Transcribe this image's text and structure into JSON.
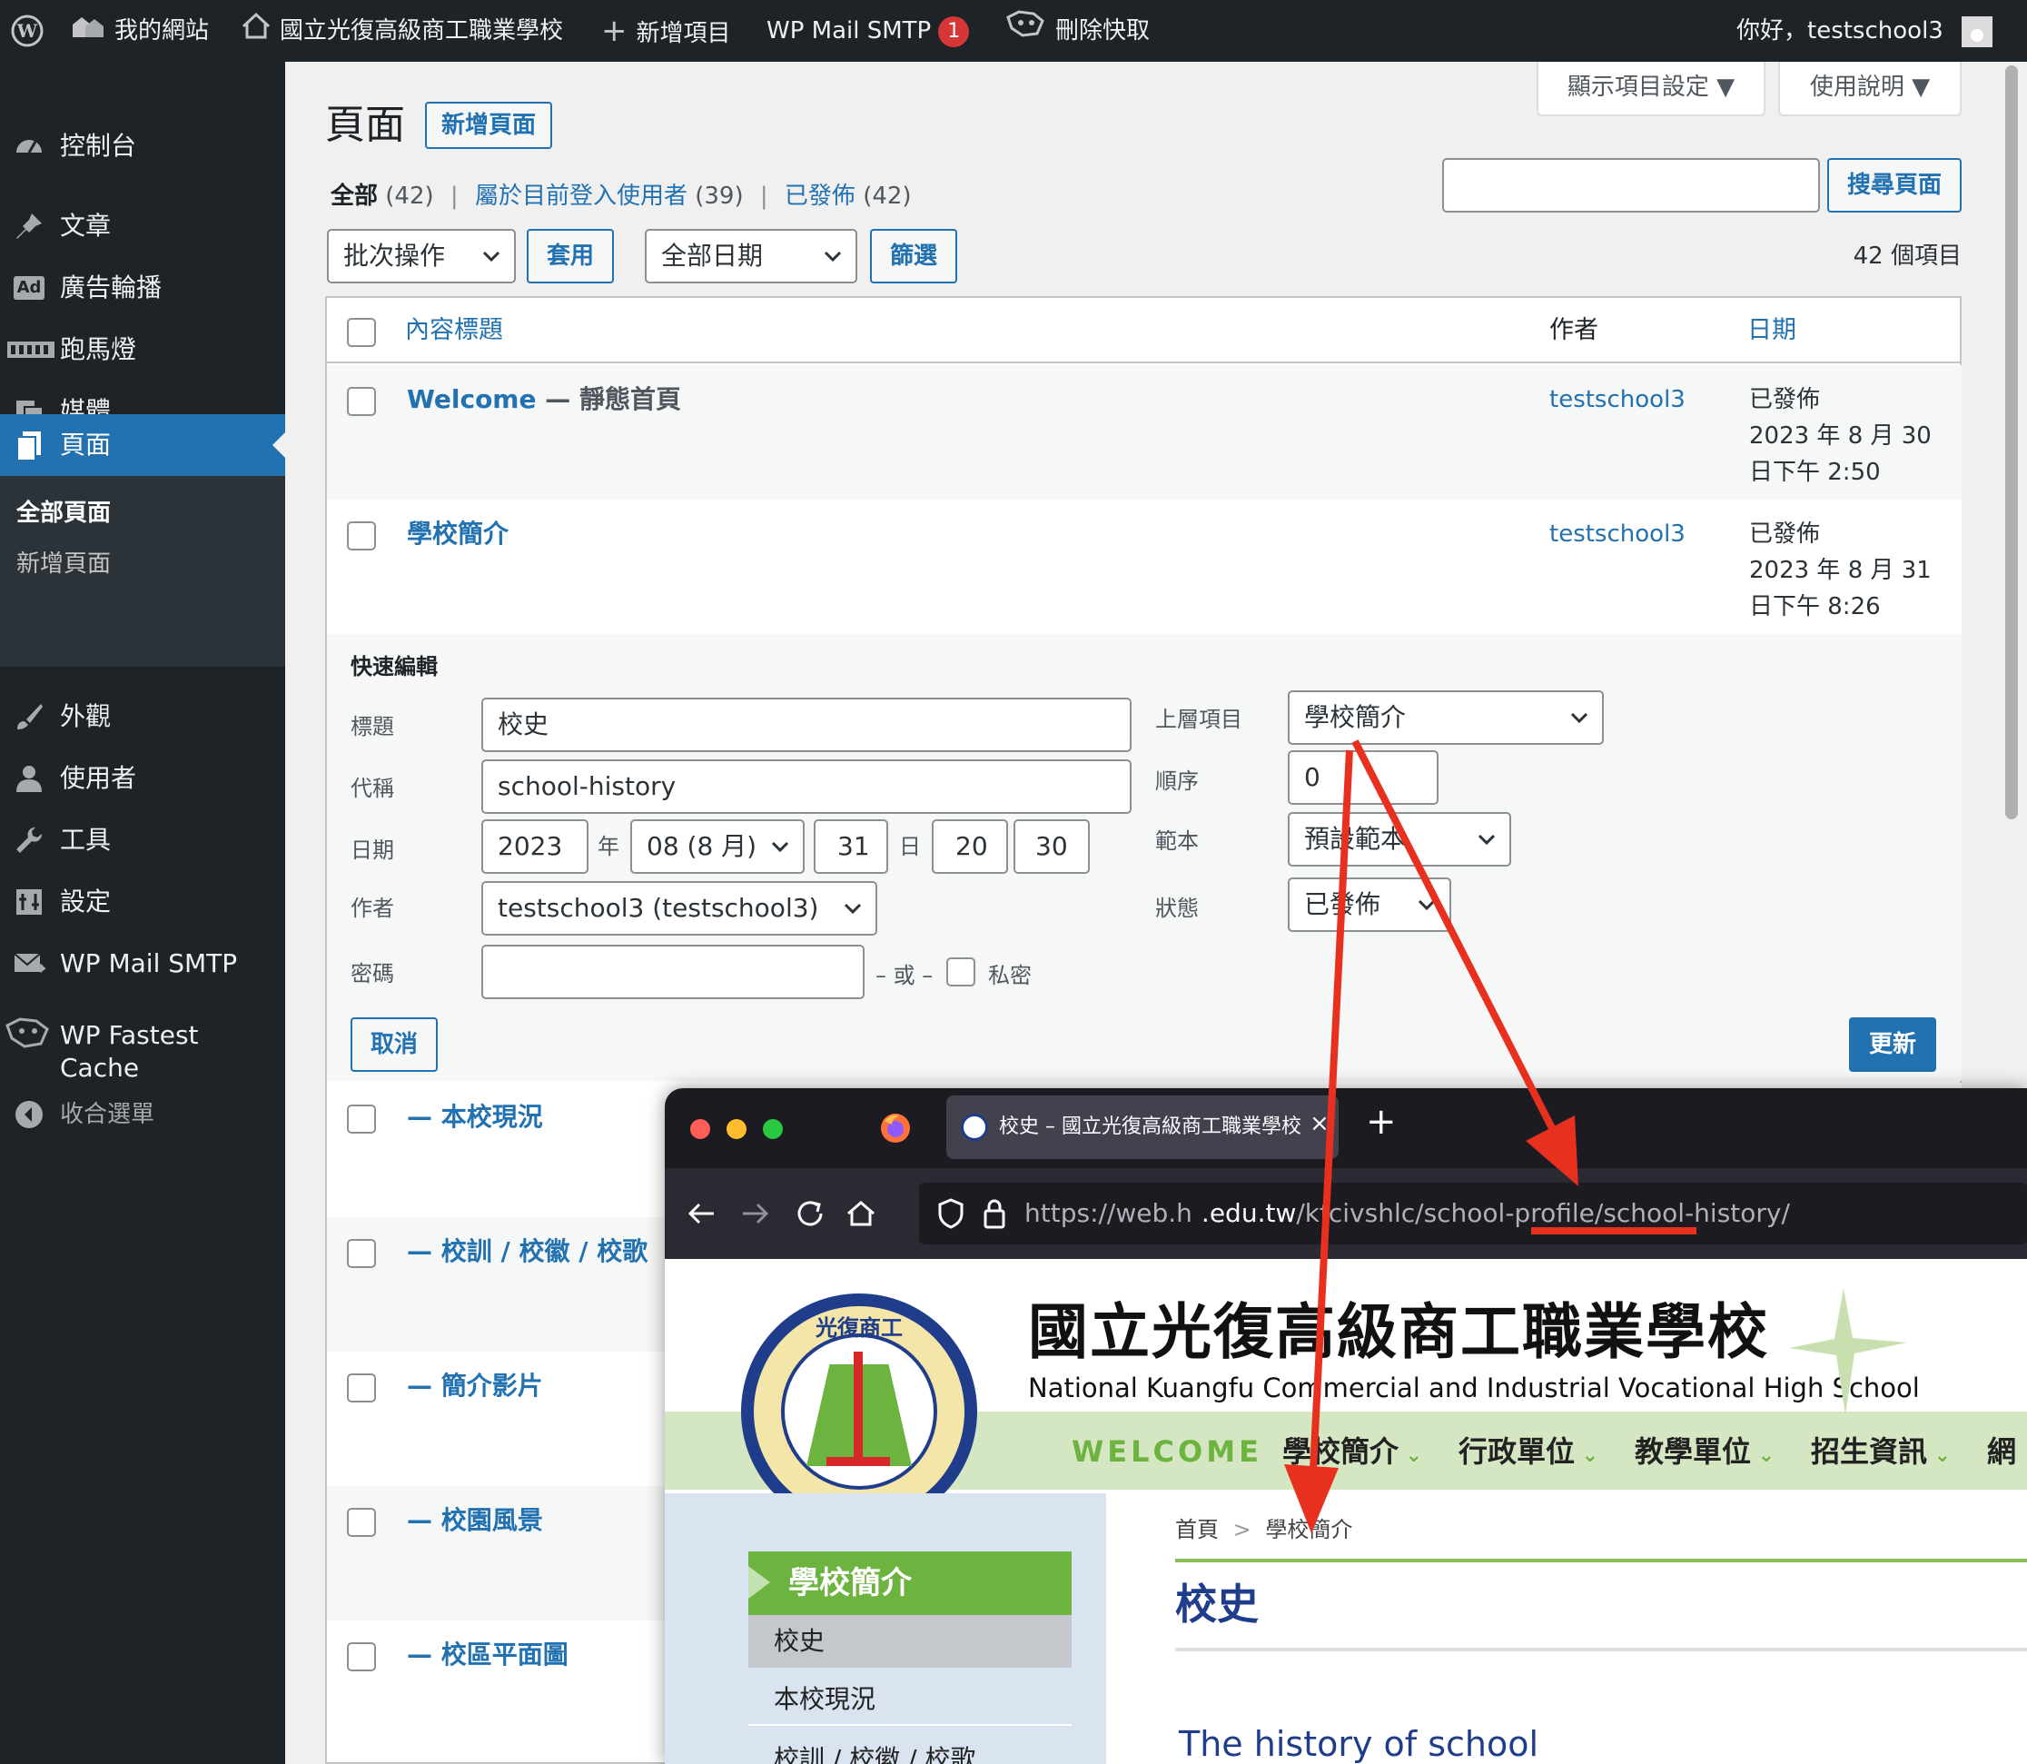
{
  "adminbar": {
    "site_name": "我的網站",
    "school_name": "國立光復高級商工職業學校",
    "new_item": "新增項目",
    "smtp": "WP Mail SMTP",
    "smtp_count": "1",
    "clear_cache": "刪除快取",
    "greeting": "你好，testschool3"
  },
  "sidebar": {
    "dashboard": "控制台",
    "posts": "文章",
    "ad_carousel": "廣告輪播",
    "marquee": "跑馬燈",
    "media": "媒體",
    "pages": "頁面",
    "all_pages": "全部頁面",
    "add_page": "新增頁面",
    "appearance": "外觀",
    "users": "使用者",
    "tools": "工具",
    "settings": "設定",
    "wp_mail_smtp": "WP Mail SMTP",
    "wp_fastest_cache_line1": "WP Fastest",
    "wp_fastest_cache_line2": "Cache",
    "collapse": "收合選單"
  },
  "screen": {
    "screen_options": "顯示項目設定 ▼",
    "help": "使用說明 ▼",
    "title": "頁面",
    "add_new": "新增頁面",
    "filter_all": "全部",
    "filter_all_count": "(42)",
    "filter_mine": "屬於目前登入使用者",
    "filter_mine_count": "(39)",
    "filter_published": "已發佈",
    "filter_published_count": "(42)",
    "search_button": "搜尋頁面",
    "bulk_action": "批次操作",
    "apply": "套用",
    "all_dates": "全部日期",
    "filter": "篩選",
    "item_count": "42 個項目"
  },
  "table": {
    "col_title": "內容標題",
    "col_author": "作者",
    "col_date": "日期",
    "rows": [
      {
        "title_a": "Welcome",
        "title_b": " — 靜態首頁",
        "author": "testschool3",
        "status": "已發佈",
        "date": "2023 年 8 月 30",
        "time": "日下午 2:50"
      },
      {
        "title_a": "學校簡介",
        "title_b": "",
        "author": "testschool3",
        "status": "已發佈",
        "date": "2023 年 8 月 31",
        "time": "日下午 8:26"
      }
    ],
    "child_rows": [
      "— 本校現況",
      "— 校訓 / 校徽 / 校歌",
      "— 簡介影片",
      "— 校園風景",
      "— 校區平面圖"
    ]
  },
  "quick_edit": {
    "heading": "快速編輯",
    "title_label": "標題",
    "title_value": "校史",
    "slug_label": "代稱",
    "slug_value": "school-history",
    "date_label": "日期",
    "year": "2023",
    "year_unit": "年",
    "month": "08 (8 月)",
    "day": "31",
    "day_unit": "日",
    "hour": "20",
    "colon": ":",
    "minute": "30",
    "author_label": "作者",
    "author_value": "testschool3 (testschool3)",
    "password_label": "密碼",
    "or": "– 或 –",
    "private": "私密",
    "parent_label": "上層項目",
    "parent_value": "學校簡介",
    "order_label": "順序",
    "order_value": "0",
    "template_label": "範本",
    "template_value": "預設範本",
    "status_label": "狀態",
    "status_value": "已發佈",
    "cancel": "取消",
    "update": "更新"
  },
  "browser": {
    "tab_title": "校史 – 國立光復高級商工職業學校",
    "url_host": "https://web.h",
    "url_host2": ".edu.tw",
    "url_path1": "/kfcivshlc/",
    "url_path2": "school-profile/school-history/",
    "site_title_zh": "國立光復高級商工職業學校",
    "site_title_en": "National Kuangfu Commercial and Industrial Vocational High School",
    "seal_text": "光復商工",
    "nav": [
      "WELCOME",
      "學校簡介",
      "行政單位",
      "教學單位",
      "招生資訊",
      "網"
    ],
    "side_menu_title": "學校簡介",
    "side_menu_items": [
      "校史",
      "本校現況",
      "校訓 / 校徽 / 校歌"
    ],
    "breadcrumb_home": "首頁",
    "breadcrumb_sep": ">",
    "breadcrumb_current": "學校簡介",
    "page_title": "校史",
    "subtitle": "The history of school"
  },
  "colors": {
    "wp_blue": "#2271b1",
    "admin_dark": "#1d2327",
    "annotation_red": "#e8301e",
    "school_green": "#6db33f"
  }
}
